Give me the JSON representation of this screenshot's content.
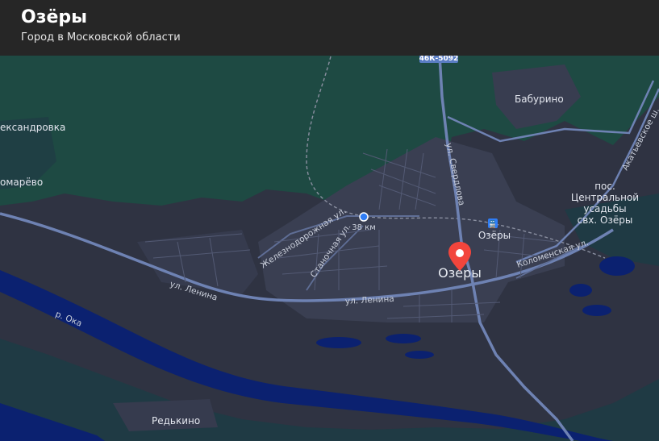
{
  "header": {
    "title": "Озёры",
    "subtitle": "Город в Московской области"
  },
  "map": {
    "place_labels": {
      "city": "Озеры",
      "baburino": "Бабурино",
      "aleksandrovka": "ександровка",
      "komarevo": "омарёво",
      "redkino": "Редькино",
      "pos_line1": "пос.",
      "pos_line2": "Центральной",
      "pos_line3": "усадьбы",
      "pos_line4": "свх. Озёры"
    },
    "stations": {
      "km38": "38 км",
      "ozery": "Озёры"
    },
    "street_labels": {
      "sverdlova": "ул. Свердлова",
      "lenina_west": "ул. Ленина",
      "lenina_east": "ул. Ленина",
      "zheleznodorozhnaya": "Железнодорожная ул.",
      "stanochnaya": "Станочная ул.",
      "kolomenskaya": "Коломенская ул.",
      "akatievskoe": "Акатьевское ш.",
      "oka": "р. Ока"
    },
    "road_shield": "46К-5092",
    "colors": {
      "forest": "#1e4a43",
      "field": "#2f3342",
      "water": "#0b2170",
      "road": "#6e82b3",
      "marker": "#f2453c"
    }
  }
}
